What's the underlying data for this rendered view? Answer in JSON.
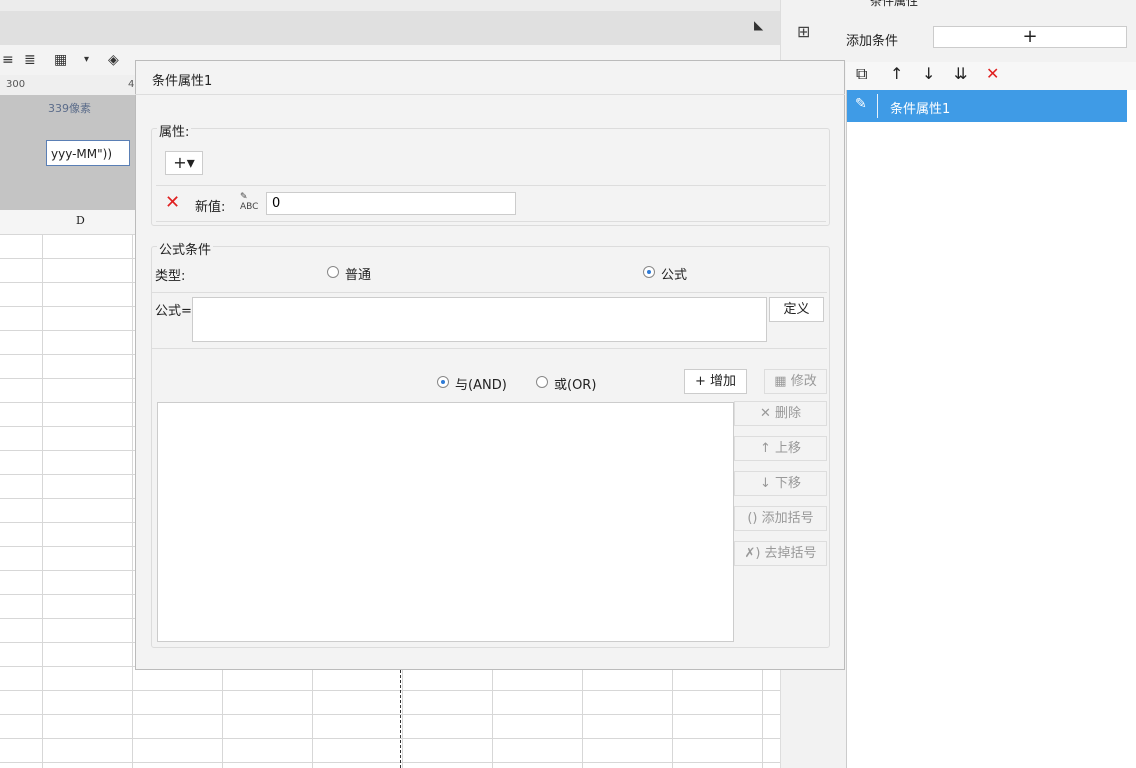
{
  "toolbar": {
    "ruler_value": "300",
    "ruler_value2": "4",
    "pixel_label": "339像素",
    "cell_text": "yyy-MM\"))",
    "column_header": "D"
  },
  "right_panel": {
    "title": "条件属性",
    "add_condition_label": "添加条件",
    "add_condition_button": "+",
    "tools": {
      "copy": "copy-icon",
      "up": "arrow-up-icon",
      "down": "arrow-down-icon",
      "bottom": "move-bottom-icon",
      "delete": "delete-icon"
    },
    "items": [
      {
        "label": "条件属性1",
        "selected": true
      }
    ]
  },
  "dialog": {
    "title": "条件属性1",
    "property_section": {
      "legend": "属性:",
      "add_button": "+▾",
      "new_value_label": "新值:",
      "new_value_type_icon": "ABC",
      "new_value": "0"
    },
    "formula_section": {
      "legend": "公式条件",
      "type_label": "类型:",
      "type_options": [
        {
          "label": "普通",
          "selected": false
        },
        {
          "label": "公式",
          "selected": true
        }
      ],
      "formula_label": "公式=",
      "formula_value": "",
      "define_button": "定义",
      "logic_options": [
        {
          "label": "与(AND)",
          "selected": true
        },
        {
          "label": "或(OR)",
          "selected": false
        }
      ],
      "add_button": "增加",
      "modify_button": "修改",
      "delete_button": "删除",
      "move_up_button": "上移",
      "move_down_button": "下移",
      "add_paren_button": "添加括号",
      "remove_paren_button": "去掉括号"
    }
  },
  "colors": {
    "selection": "#3f9be6",
    "delete_red": "#e02020",
    "dialog_bg": "#f3f3f3"
  }
}
